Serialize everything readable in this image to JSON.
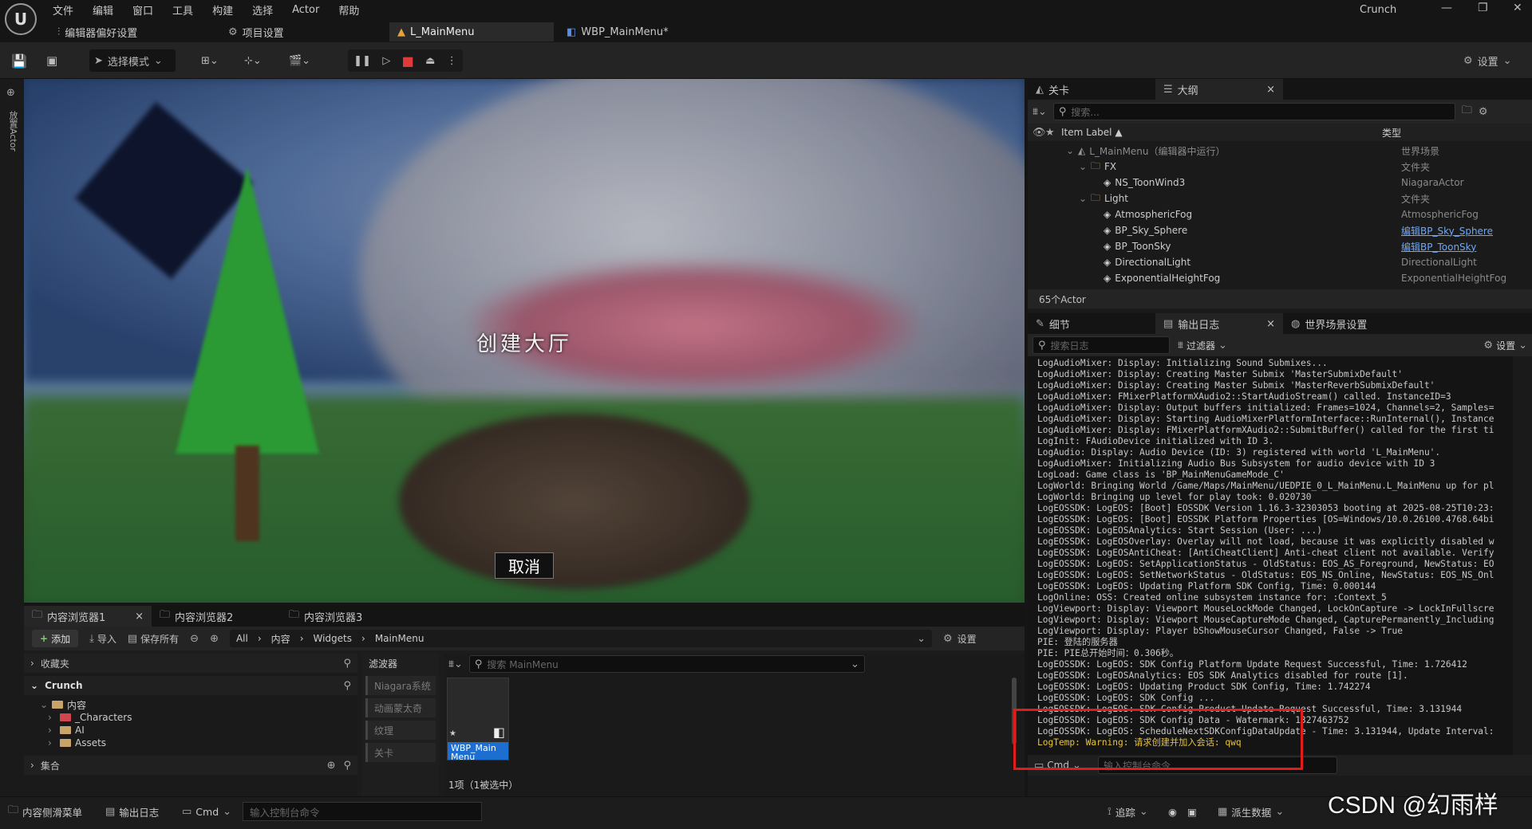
{
  "app": {
    "logo": "U",
    "menus": [
      "文件",
      "编辑",
      "窗口",
      "工具",
      "构建",
      "选择",
      "Actor",
      "帮助"
    ],
    "name": "Crunch",
    "window_controls": [
      "—",
      "❐",
      "✕"
    ]
  },
  "doc_tabs": [
    {
      "label": "编辑器偏好设置",
      "icon": "sliders-icon"
    },
    {
      "label": "项目设置",
      "icon": "gear-icon"
    },
    {
      "label": "L_MainMenu",
      "icon": "level-icon",
      "active": true
    },
    {
      "label": "WBP_MainMenu*",
      "icon": "widget-icon"
    }
  ],
  "toolbar": {
    "mode_label": "选择模式",
    "settings_label": "设置"
  },
  "left_strip": {
    "label": "放置Actor"
  },
  "viewport": {
    "title_text": "创建大厅",
    "cancel_text": "取消"
  },
  "right_tabs_top": [
    {
      "label": "关卡",
      "icon": "level-icon"
    },
    {
      "label": "大纲",
      "icon": "list-icon",
      "active": true,
      "close": "×"
    }
  ],
  "outliner": {
    "search_placeholder": "搜索...",
    "col_label": "Item Label ▲",
    "col_type": "类型",
    "rows": [
      {
        "indent": 0,
        "label": "L_MainMenu（编辑器中运行）",
        "type": "世界场景",
        "kind": "level",
        "muted": true
      },
      {
        "indent": 1,
        "label": "FX",
        "type": "文件夹",
        "kind": "folder"
      },
      {
        "indent": 2,
        "label": "NS_ToonWind3",
        "type": "NiagaraActor",
        "kind": "actor"
      },
      {
        "indent": 1,
        "label": "Light",
        "type": "文件夹",
        "kind": "folder"
      },
      {
        "indent": 2,
        "label": "AtmosphericFog",
        "type": "AtmosphericFog",
        "kind": "actor"
      },
      {
        "indent": 2,
        "label": "BP_Sky_Sphere",
        "type": "编辑BP_Sky_Sphere",
        "kind": "actor",
        "link": true
      },
      {
        "indent": 2,
        "label": "BP_ToonSky",
        "type": "编辑BP_ToonSky",
        "kind": "actor",
        "link": true
      },
      {
        "indent": 2,
        "label": "DirectionalLight",
        "type": "DirectionalLight",
        "kind": "actor"
      },
      {
        "indent": 2,
        "label": "ExponentialHeightFog",
        "type": "ExponentialHeightFog",
        "kind": "actor"
      }
    ],
    "actor_count": "65个Actor"
  },
  "right_tabs_bottom": [
    {
      "label": "细节",
      "icon": "pencil-icon"
    },
    {
      "label": "输出日志",
      "icon": "log-icon",
      "active": true,
      "close": "×"
    },
    {
      "label": "世界场景设置",
      "icon": "globe-icon"
    }
  ],
  "output_log": {
    "search_placeholder": "搜索日志",
    "filter_label": "过滤器",
    "settings_label": "设置",
    "lines": [
      {
        "text": "LogAudioMixer: Display: Initializing Sound Submixes..."
      },
      {
        "text": "LogAudioMixer: Display: Creating Master Submix 'MasterSubmixDefault'"
      },
      {
        "text": "LogAudioMixer: Display: Creating Master Submix 'MasterReverbSubmixDefault'"
      },
      {
        "text": "LogAudioMixer: FMixerPlatformXAudio2::StartAudioStream() called. InstanceID=3"
      },
      {
        "text": "LogAudioMixer: Display: Output buffers initialized: Frames=1024, Channels=2, Samples="
      },
      {
        "text": "LogAudioMixer: Display: Starting AudioMixerPlatformInterface::RunInternal(), Instance"
      },
      {
        "text": "LogAudioMixer: Display: FMixerPlatformXAudio2::SubmitBuffer() called for the first ti"
      },
      {
        "text": "LogInit: FAudioDevice initialized with ID 3."
      },
      {
        "text": "LogAudio: Display: Audio Device (ID: 3) registered with world 'L_MainMenu'."
      },
      {
        "text": "LogAudioMixer: Initializing Audio Bus Subsystem for audio device with ID 3"
      },
      {
        "text": "LogLoad: Game class is 'BP_MainMenuGameMode_C'"
      },
      {
        "text": "LogWorld: Bringing World /Game/Maps/MainMenu/UEDPIE_0_L_MainMenu.L_MainMenu up for pl"
      },
      {
        "text": "LogWorld: Bringing up level for play took: 0.020730"
      },
      {
        "text": "LogEOSSDK: LogEOS: [Boot] EOSSDK Version 1.16.3-32303053 booting at 2025-08-25T10:23:"
      },
      {
        "text": "LogEOSSDK: LogEOS: [Boot] EOSSDK Platform Properties [OS=Windows/10.0.26100.4768.64bi"
      },
      {
        "text": "LogEOSSDK: LogEOSAnalytics: Start Session (User: ...)"
      },
      {
        "text": "LogEOSSDK: LogEOSOverlay: Overlay will not load, because it was explicitly disabled w"
      },
      {
        "text": "LogEOSSDK: LogEOSAntiCheat: [AntiCheatClient] Anti-cheat client not available. Verify"
      },
      {
        "text": "LogEOSSDK: LogEOS: SetApplicationStatus - OldStatus: EOS_AS_Foreground, NewStatus: EO"
      },
      {
        "text": "LogEOSSDK: LogEOS: SetNetworkStatus - OldStatus: EOS_NS_Online, NewStatus: EOS_NS_Onl"
      },
      {
        "text": "LogEOSSDK: LogEOS: Updating Platform SDK Config, Time: 0.000144"
      },
      {
        "text": "LogOnline: OSS: Created online subsystem instance for: :Context_5"
      },
      {
        "text": "LogViewport: Display: Viewport MouseLockMode Changed, LockOnCapture -> LockInFullscre"
      },
      {
        "text": "LogViewport: Display: Viewport MouseCaptureMode Changed, CapturePermanently_Including"
      },
      {
        "text": "LogViewport: Display: Player bShowMouseCursor Changed, False -> True"
      },
      {
        "text": "PIE: 登陆的服务器"
      },
      {
        "text": "PIE: PIE总开始时间：0.306秒。"
      },
      {
        "text": "LogEOSSDK: LogEOS: SDK Config Platform Update Request Successful, Time: 1.726412"
      },
      {
        "text": "LogEOSSDK: LogEOSAnalytics: EOS SDK Analytics disabled for route [1]."
      },
      {
        "text": "LogEOSSDK: LogEOS: Updating Product SDK Config, Time: 1.742274"
      },
      {
        "text": "LogEOSSDK: LogEOS: SDK Config ..."
      },
      {
        "text": "LogEOSSDK: LogEOS: SDK Config Product Update Request Successful, Time: 3.131944"
      },
      {
        "text": "LogEOSSDK: LogEOS: SDK Config Data - Watermark: 1327463752"
      },
      {
        "text": "LogEOSSDK: LogEOS: ScheduleNextSDKConfigDataUpdate - Time: 3.131944, Update Interval:"
      },
      {
        "text": "LogTemp: Warning: 请求创建并加入会话: qwq",
        "warn": true
      }
    ],
    "cmd_label": "Cmd",
    "cmd_placeholder": "输入控制台命令"
  },
  "content_browser": {
    "tabs": [
      {
        "label": "内容浏览器1",
        "active": true,
        "close": "×"
      },
      {
        "label": "内容浏览器2"
      },
      {
        "label": "内容浏览器3"
      }
    ],
    "add_label": "添加",
    "import_label": "导入",
    "save_all_label": "保存所有",
    "breadcrumb": [
      "All",
      "内容",
      "Widgets",
      "MainMenu"
    ],
    "settings_label": "设置",
    "favorites_label": "收藏夹",
    "project_label": "Crunch",
    "tree": [
      {
        "indent": 1,
        "label": "内容",
        "open": true
      },
      {
        "indent": 2,
        "label": "_Characters",
        "red": true
      },
      {
        "indent": 2,
        "label": "AI"
      },
      {
        "indent": 2,
        "label": "Assets"
      }
    ],
    "collections_label": "集合",
    "filters_label": "滤波器",
    "filter_chips": [
      "Niagara系统",
      "动画蒙太奇",
      "纹理",
      "关卡"
    ],
    "search_placeholder": "搜索 MainMenu",
    "asset_name": "WBP_Main Menu",
    "selection_status": "1项（1被选中）"
  },
  "statusbar": {
    "drawer_label": "内容侧滑菜单",
    "output_log_label": "输出日志",
    "cmd_label": "Cmd",
    "cmd_placeholder": "输入控制台命令",
    "trace_label": "追踪",
    "derived_data_label": "派生数据"
  },
  "watermark": "CSDN @幻雨样"
}
